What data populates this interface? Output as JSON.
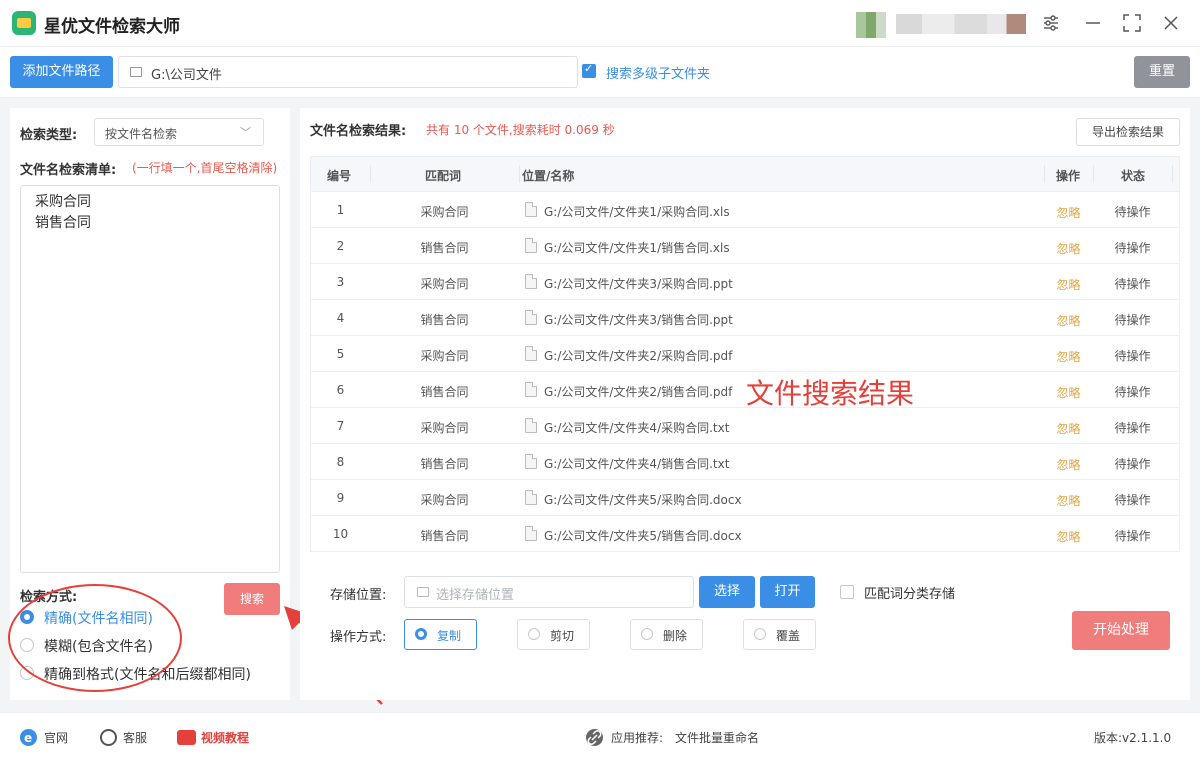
{
  "app": {
    "title": "星优文件检索大师"
  },
  "toolbar": {
    "add_path_label": "添加文件路径",
    "path_value": "G:\\公司文件",
    "search_subfolders_label": "搜索多级子文件夹",
    "search_subfolders_checked": true,
    "reset_label": "重置"
  },
  "left": {
    "search_type_label": "检索类型:",
    "search_type_value": "按文件名检索",
    "names_list_label": "文件名检索清单:",
    "names_list_hint": "(一行填一个,首尾空格清除)",
    "names": [
      "采购合同",
      "销售合同"
    ],
    "search_mode_label": "检索方式:",
    "search_button": "搜索",
    "modes": [
      {
        "label": "精确(文件名相同)",
        "selected": true
      },
      {
        "label": "模糊(包含文件名)",
        "selected": false
      },
      {
        "label": "精确到格式(文件名和后缀都相同)",
        "selected": false
      }
    ]
  },
  "results": {
    "title": "文件名检索结果:",
    "summary": "共有 10 个文件,搜索耗时 0.069 秒",
    "export_label": "导出检索结果",
    "columns": [
      "编号",
      "匹配词",
      "位置/名称",
      "操作",
      "状态"
    ],
    "rows": [
      {
        "no": "1",
        "keyword": "采购合同",
        "path": "G:/公司文件/文件夹1/采购合同.xls",
        "action": "忽略",
        "status": "待操作"
      },
      {
        "no": "2",
        "keyword": "销售合同",
        "path": "G:/公司文件/文件夹1/销售合同.xls",
        "action": "忽略",
        "status": "待操作"
      },
      {
        "no": "3",
        "keyword": "采购合同",
        "path": "G:/公司文件/文件夹3/采购合同.ppt",
        "action": "忽略",
        "status": "待操作"
      },
      {
        "no": "4",
        "keyword": "销售合同",
        "path": "G:/公司文件/文件夹3/销售合同.ppt",
        "action": "忽略",
        "status": "待操作"
      },
      {
        "no": "5",
        "keyword": "采购合同",
        "path": "G:/公司文件/文件夹2/采购合同.pdf",
        "action": "忽略",
        "status": "待操作"
      },
      {
        "no": "6",
        "keyword": "销售合同",
        "path": "G:/公司文件/文件夹2/销售合同.pdf",
        "action": "忽略",
        "status": "待操作"
      },
      {
        "no": "7",
        "keyword": "采购合同",
        "path": "G:/公司文件/文件夹4/采购合同.txt",
        "action": "忽略",
        "status": "待操作"
      },
      {
        "no": "8",
        "keyword": "销售合同",
        "path": "G:/公司文件/文件夹4/销售合同.txt",
        "action": "忽略",
        "status": "待操作"
      },
      {
        "no": "9",
        "keyword": "采购合同",
        "path": "G:/公司文件/文件夹5/采购合同.docx",
        "action": "忽略",
        "status": "待操作"
      },
      {
        "no": "10",
        "keyword": "销售合同",
        "path": "G:/公司文件/文件夹5/销售合同.docx",
        "action": "忽略",
        "status": "待操作"
      }
    ],
    "overlay_caption": "文件搜索结果"
  },
  "bottom": {
    "save_location_label": "存储位置:",
    "save_location_placeholder": "选择存储位置",
    "choose_label": "选择",
    "open_label": "打开",
    "classify_label": "匹配词分类存储",
    "operation_label": "操作方式:",
    "operations": [
      {
        "label": "复制",
        "selected": true
      },
      {
        "label": "剪切",
        "selected": false
      },
      {
        "label": "删除",
        "selected": false
      },
      {
        "label": "覆盖",
        "selected": false
      }
    ],
    "start_label": "开始处理"
  },
  "statusbar": {
    "website": "官网",
    "support": "客服",
    "video": "视频教程",
    "recommend_label": "应用推荐:",
    "recommend_app": "文件批量重命名",
    "version": "版本:v2.1.1.0"
  },
  "colors": {
    "accent": "#3a8ee6",
    "danger": "#f17c7c",
    "warning": "#e6a23c",
    "annotation": "#e5403a"
  }
}
